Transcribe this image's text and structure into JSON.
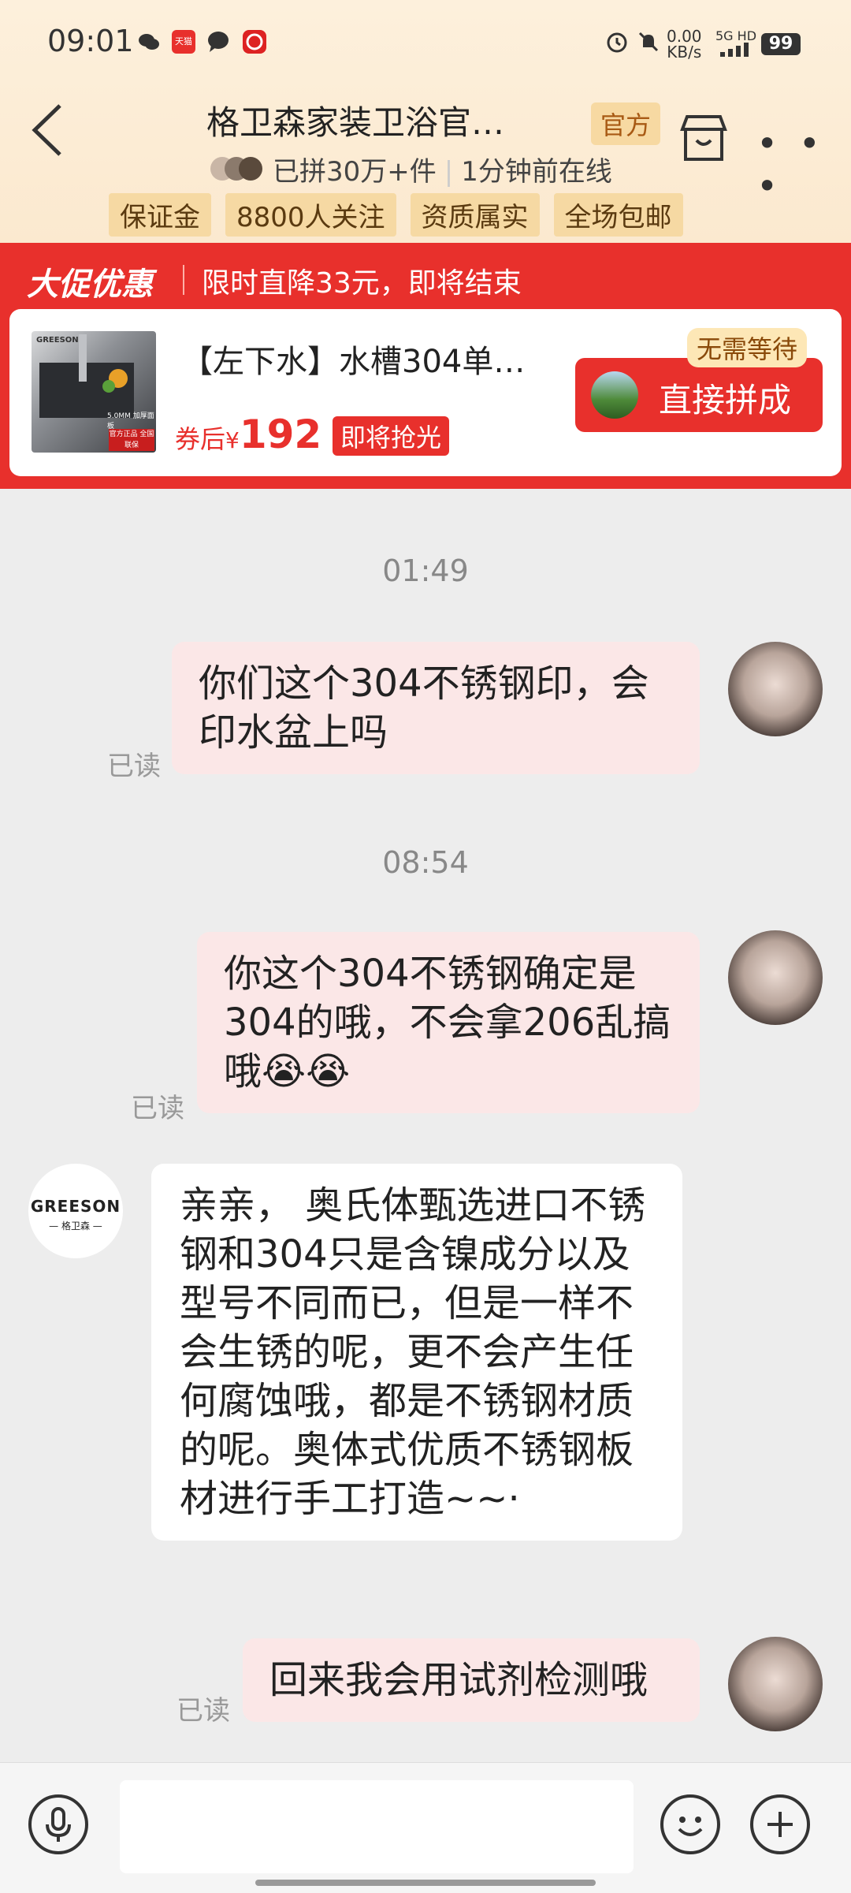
{
  "status_bar": {
    "time": "09:01",
    "net_speed": "0.00",
    "net_unit": "KB/s",
    "signal": "5G HD",
    "battery": "99",
    "tmall_label": "天猫"
  },
  "header": {
    "back_icon": "chevron-left-icon",
    "shop_name": "格卫森家装卫浴官…",
    "official_badge": "官方",
    "sold_text": "已拼30万+件",
    "online_text": "1分钟前在线",
    "tags": [
      "保证金",
      "8800人关注",
      "资质属实",
      "全场包邮"
    ],
    "store_icon": "store-icon",
    "more_icon": "more-dots-icon"
  },
  "promo": {
    "title": "大促优惠",
    "description": "限时直降33元，即将结束",
    "product": {
      "title": "【左下水】水槽304单…",
      "price_prefix": "券后",
      "price_symbol": "¥",
      "price": "192",
      "badge": "即将抢光",
      "thumb_brand": "GREESON",
      "thumb_text": "5.0MM 加厚面板",
      "thumb_badge": "官方正品 全国联保"
    },
    "no_wait": "无需等待",
    "join_button": "直接拼成"
  },
  "chat": {
    "messages": [
      {
        "type": "timestamp",
        "text": "01:49"
      },
      {
        "type": "outgoing",
        "text": "你们这个304不锈钢印，会印水盆上吗",
        "read": "已读"
      },
      {
        "type": "timestamp",
        "text": "08:54"
      },
      {
        "type": "outgoing",
        "text": "你这个304不锈钢确定是304的哦，不会拿206乱搞哦😭😭",
        "read": "已读"
      },
      {
        "type": "incoming",
        "sender_name": "GREESON",
        "sender_sub": "— 格卫森 —",
        "text": "亲亲， 奥氏体甄选进口不锈钢和304只是含镍成分以及型号不同而已，但是一样不会生锈的呢，更不会产生任何腐蚀哦，都是不锈钢材质的呢。奥体式优质不锈钢板材进行手工打造~~·"
      },
      {
        "type": "outgoing",
        "text": "回来我会用试剂检测哦",
        "read": "已读"
      }
    ]
  },
  "input_bar": {
    "mic_icon": "microphone-icon",
    "placeholder": "",
    "emoji_icon": "smile-icon",
    "plus_icon": "plus-icon"
  },
  "colors": {
    "promo_red": "#e8302c",
    "header_bg": "#fbe9cf",
    "tag_bg": "#f6d9a3",
    "outgoing_bubble": "#fbe7e7",
    "incoming_bubble": "#ffffff"
  }
}
